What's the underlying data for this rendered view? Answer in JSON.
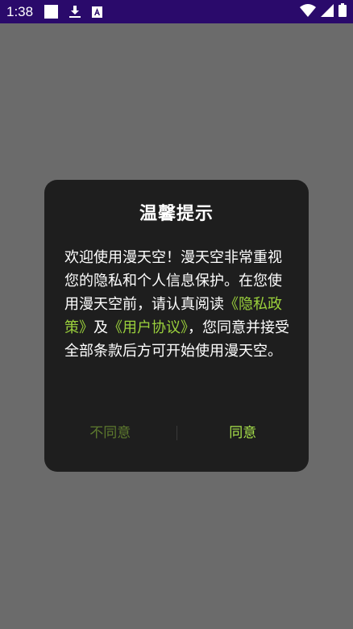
{
  "status_bar": {
    "time": "1:38",
    "icons_left": [
      "square-icon",
      "download-icon",
      "keyboard-a-icon"
    ],
    "icons_right": [
      "wifi-icon",
      "signal-icon",
      "battery-icon"
    ],
    "background": "#2a0a6b"
  },
  "dialog": {
    "title": "温馨提示",
    "body": {
      "text_before": "欢迎使用漫天空！漫天空非常重视您的隐私和个人信息保护。在您使用漫天空前，请认真阅读",
      "privacy_link": "《隐私政策》",
      "conjunction": "及",
      "agreement_link": "《用户协议》",
      "text_after": "，您同意并接受全部条款后方可开始使用漫天空。"
    },
    "disagree_label": "不同意",
    "agree_label": "同意",
    "accent_color": "#a6e04a",
    "background": "#1e1e1e"
  }
}
